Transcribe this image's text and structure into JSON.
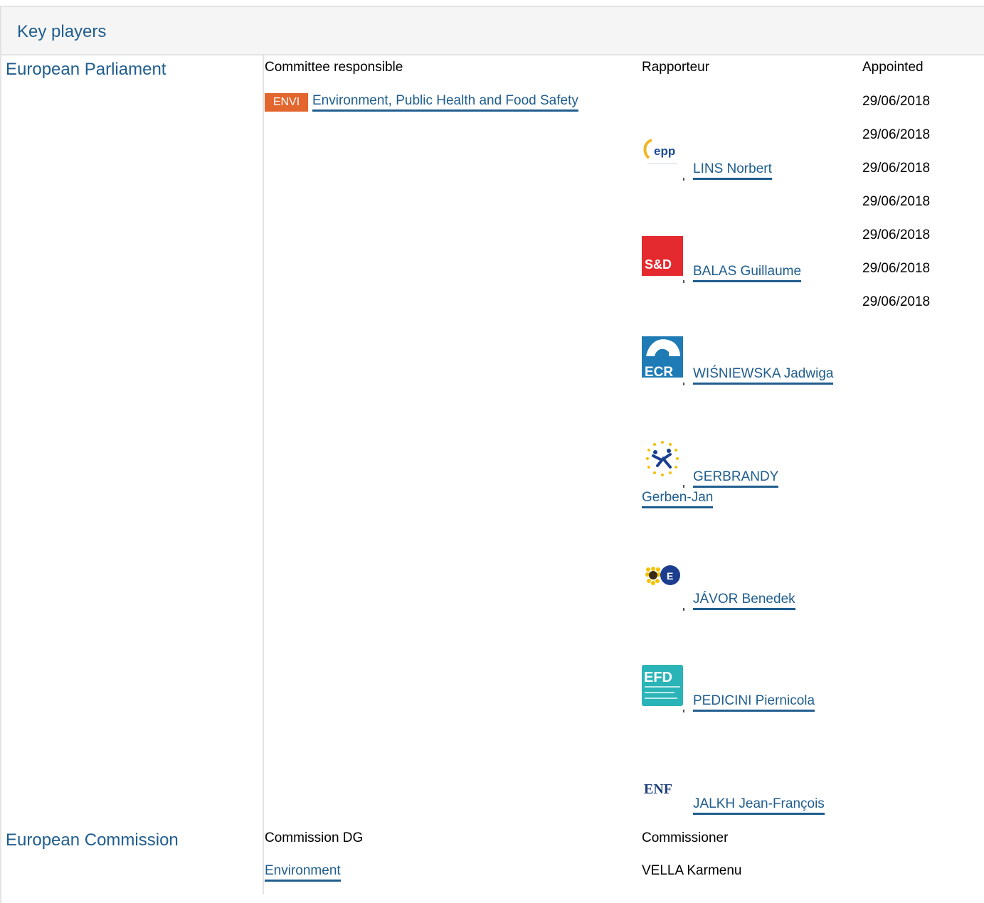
{
  "section": {
    "title": "Key players"
  },
  "parliament": {
    "label": "European Parliament",
    "col_committee": "Committee responsible",
    "col_rapporteur": "Rapporteur",
    "col_appointed": "Appointed",
    "committee": {
      "badge": "ENVI",
      "name": "Environment, Public Health and Food Safety",
      "badge_color": "#e3662e"
    },
    "appointed_dates": [
      "29/06/2018",
      "29/06/2018",
      "29/06/2018",
      "29/06/2018",
      "29/06/2018",
      "29/06/2018",
      "29/06/2018"
    ],
    "rapporteurs": [
      {
        "group_logo": "epp",
        "name": "LINS Norbert"
      },
      {
        "group_logo": "S&D",
        "name": "BALAS Guillaume"
      },
      {
        "group_logo": "ECR",
        "name": "WIŚNIEWSKA Jadwiga"
      },
      {
        "group_logo": "alde-stars",
        "name_line1": "GERBRANDY",
        "name_line2": "Gerben-Jan"
      },
      {
        "group_logo": "greens-efa",
        "name": "JÁVOR Benedek"
      },
      {
        "group_logo": "EFD",
        "name": "PEDICINI Piernicola"
      },
      {
        "group_logo": "ENF",
        "name": "JALKH Jean-François"
      }
    ]
  },
  "commission": {
    "label": "European Commission",
    "col_dg": "Commission DG",
    "col_commissioner": "Commissioner",
    "dg": "Environment",
    "commissioner": "VELLA Karmenu"
  }
}
